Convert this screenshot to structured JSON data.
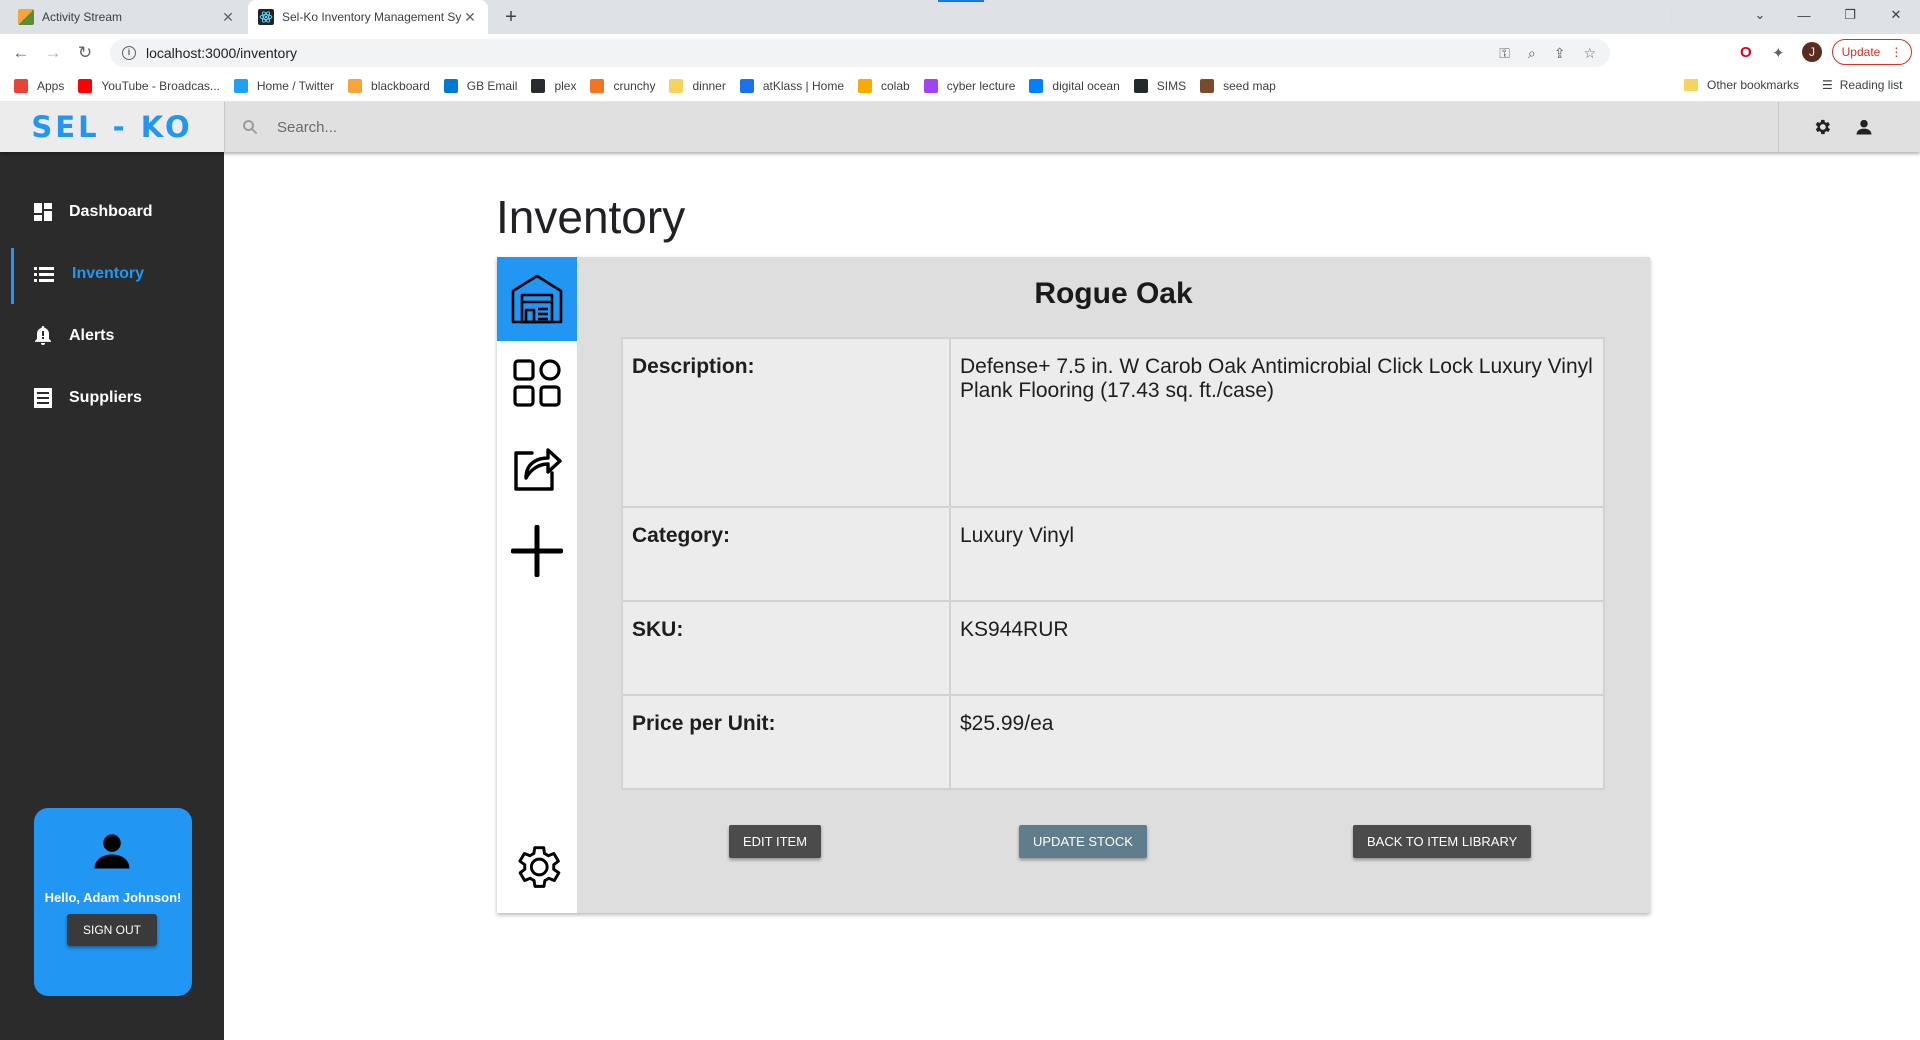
{
  "browser": {
    "tabs": [
      {
        "title": "Activity Stream",
        "active": false,
        "favicon_color": "#f4a63a"
      },
      {
        "title": "Sel-Ko Inventory Management Sy",
        "active": true,
        "favicon_color": "#20232a"
      }
    ],
    "url": "localhost:3000/inventory",
    "update_label": "Update",
    "profile_initial": "J",
    "bookmarks": [
      {
        "label": "Apps",
        "icon": "apps-grid-icon",
        "color": "#ea4335"
      },
      {
        "label": "YouTube - Broadcas...",
        "icon": "youtube-icon",
        "color": "#ff0000"
      },
      {
        "label": "Home / Twitter",
        "icon": "twitter-icon",
        "color": "#1da1f2"
      },
      {
        "label": "blackboard",
        "icon": "blackboard-icon",
        "color": "#f4a63a"
      },
      {
        "label": "GB Email",
        "icon": "outlook-icon",
        "color": "#0078d4"
      },
      {
        "label": "plex",
        "icon": "plex-icon",
        "color": "#282a2d"
      },
      {
        "label": "crunchy",
        "icon": "crunchyroll-icon",
        "color": "#f47521"
      },
      {
        "label": "dinner",
        "icon": "folder-icon",
        "color": "#f6d35b"
      },
      {
        "label": "atKlass | Home",
        "icon": "atklass-icon",
        "color": "#1a73e8"
      },
      {
        "label": "colab",
        "icon": "colab-icon",
        "color": "#f9ab00"
      },
      {
        "label": "cyber lecture",
        "icon": "cyber-lecture-icon",
        "color": "#a142f4"
      },
      {
        "label": "digital ocean",
        "icon": "digital-ocean-icon",
        "color": "#0080ff"
      },
      {
        "label": "SIMS",
        "icon": "github-icon",
        "color": "#24292e"
      },
      {
        "label": "seed map",
        "icon": "seed-map-icon",
        "color": "#7a4a2a"
      }
    ],
    "other_bookmarks": "Other bookmarks",
    "reading_list": "Reading list"
  },
  "app": {
    "brand": "SEL - KO",
    "brand_color": "#2196f3",
    "search_placeholder": "Search...",
    "nav": [
      {
        "label": "Dashboard",
        "icon": "dashboard-icon",
        "active": false
      },
      {
        "label": "Inventory",
        "icon": "list-icon",
        "active": true
      },
      {
        "label": "Alerts",
        "icon": "bell-icon",
        "active": false
      },
      {
        "label": "Suppliers",
        "icon": "document-icon",
        "active": false
      }
    ],
    "user": {
      "greeting": "Hello, Adam Johnson!",
      "sign_out": "SIGN OUT"
    }
  },
  "page": {
    "title": "Inventory",
    "rail": [
      {
        "icon": "warehouse-icon",
        "selected": true
      },
      {
        "icon": "grid-apps-icon",
        "selected": false
      },
      {
        "icon": "share-export-icon",
        "selected": false
      },
      {
        "icon": "plus-icon",
        "selected": false
      },
      {
        "icon": "settings-gear-icon",
        "selected": false
      }
    ],
    "item": {
      "name": "Rogue Oak",
      "fields": [
        {
          "label": "Description:",
          "value": "Defense+ 7.5 in. W Carob Oak Antimicrobial Click Lock Luxury Vinyl Plank Flooring (17.43 sq. ft./case)"
        },
        {
          "label": "Category:",
          "value": "Luxury Vinyl"
        },
        {
          "label": "SKU:",
          "value": "KS944RUR"
        },
        {
          "label": "Price per Unit:",
          "value": "$25.99/ea"
        }
      ]
    },
    "actions": {
      "edit": "EDIT ITEM",
      "update_stock": "UPDATE STOCK",
      "back": "BACK TO ITEM LIBRARY"
    }
  }
}
